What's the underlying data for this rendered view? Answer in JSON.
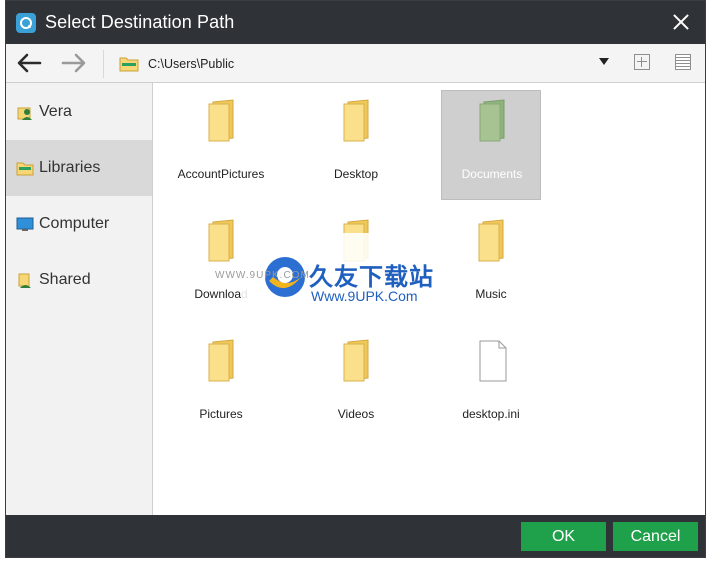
{
  "dialog": {
    "title": "Select Destination Path"
  },
  "toolbar": {
    "path": "C:\\Users\\Public"
  },
  "sidebar": {
    "items": [
      {
        "label": "Vera",
        "icon": "user-icon"
      },
      {
        "label": "Libraries",
        "icon": "library-icon"
      },
      {
        "label": "Computer",
        "icon": "computer-icon"
      },
      {
        "label": "Shared",
        "icon": "shared-icon"
      }
    ],
    "selected": "Libraries"
  },
  "files": [
    {
      "name": "AccountPictures",
      "type": "folder"
    },
    {
      "name": "Desktop",
      "type": "folder"
    },
    {
      "name": "Documents",
      "type": "folder",
      "selected": true
    },
    {
      "name": "Download",
      "type": "folder"
    },
    {
      "name": "Music",
      "type": "folder"
    },
    {
      "name": "Pictures",
      "type": "folder"
    },
    {
      "name": "Videos",
      "type": "folder"
    },
    {
      "name": "desktop.ini",
      "type": "file"
    }
  ],
  "watermark": {
    "small_text": "WWW.9UPK.COM",
    "title": "久友下载站",
    "url": "Www.9UPK.Com"
  },
  "footer": {
    "ok_label": "OK",
    "cancel_label": "Cancel"
  },
  "colors": {
    "titlebar": "#2f3236",
    "button_green": "#1fa04a",
    "selected_item": "#cfcfcf",
    "folder_yellow": "#f6d774"
  }
}
